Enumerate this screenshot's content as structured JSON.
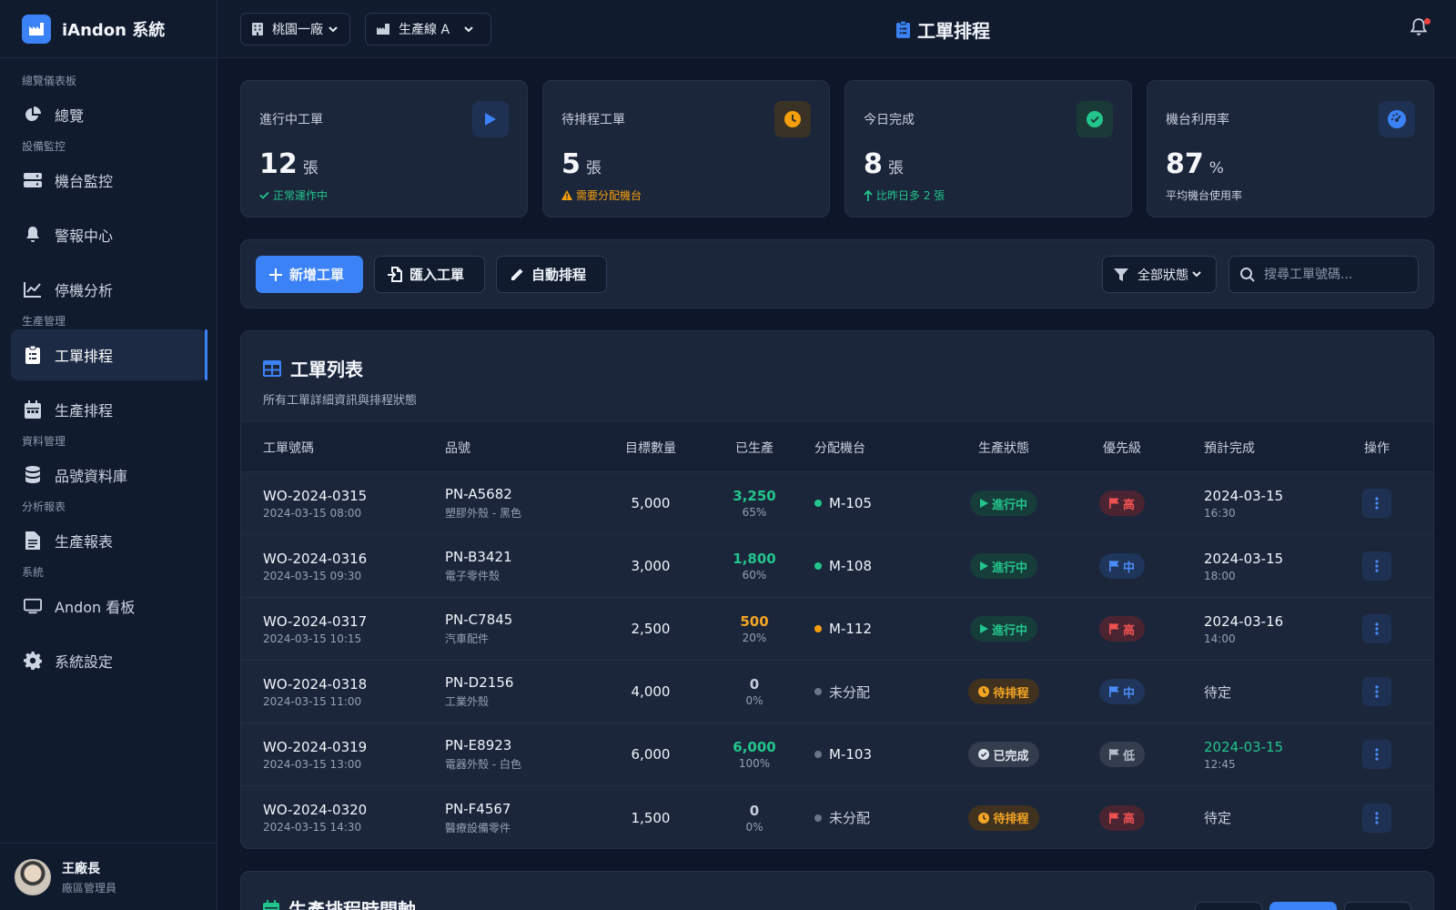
{
  "brand": {
    "title": "iAndon 系統"
  },
  "sidebar": {
    "sections": [
      {
        "label": "總覽儀表板",
        "items": [
          {
            "label": "總覽",
            "icon": "pie-chart-icon"
          }
        ]
      },
      {
        "label": "設備監控",
        "items": [
          {
            "label": "機台監控",
            "icon": "server-icon"
          },
          {
            "label": "警報中心",
            "icon": "bell-icon"
          },
          {
            "label": "停機分析",
            "icon": "line-chart-icon"
          }
        ]
      },
      {
        "label": "生產管理",
        "items": [
          {
            "label": "工單排程",
            "icon": "clipboard-icon",
            "active": true
          },
          {
            "label": "生產排程",
            "icon": "calendar-icon"
          }
        ]
      },
      {
        "label": "資料管理",
        "items": [
          {
            "label": "品號資料庫",
            "icon": "database-icon"
          }
        ]
      },
      {
        "label": "分析報表",
        "items": [
          {
            "label": "生產報表",
            "icon": "file-icon"
          }
        ]
      },
      {
        "label": "系統",
        "items": [
          {
            "label": "Andon 看板",
            "icon": "monitor-icon"
          },
          {
            "label": "系統設定",
            "icon": "gear-icon"
          }
        ]
      }
    ],
    "user": {
      "name": "王廠長",
      "role": "廠區管理員"
    }
  },
  "header": {
    "factory_select": "桃園一廠",
    "line_select": "生產線 A",
    "title": "工單排程"
  },
  "stats": [
    {
      "title": "進行中工單",
      "value": "12",
      "unit": "張",
      "sub": "正常運作中",
      "sub_color": "#22c58b",
      "icon": "play-icon",
      "icon_color": "#3b82f6"
    },
    {
      "title": "待排程工單",
      "value": "5",
      "unit": "張",
      "sub": "需要分配機台",
      "sub_color": "#f59e0b",
      "icon": "clock-icon",
      "icon_color": "#f59e0b"
    },
    {
      "title": "今日完成",
      "value": "8",
      "unit": "張",
      "sub": "比昨日多 2 張",
      "sub_color": "#22c58b",
      "icon": "check-circle-icon",
      "icon_color": "#22c58b"
    },
    {
      "title": "機台利用率",
      "value": "87",
      "unit": "%",
      "sub": "平均機台使用率",
      "sub_color": "#c7cfdc",
      "icon": "gauge-icon",
      "icon_color": "#3b82f6"
    }
  ],
  "toolbar": {
    "new_label": "新增工單",
    "import_label": "匯入工單",
    "auto_label": "自動排程",
    "filter_label": "全部狀態",
    "search_placeholder": "搜尋工單號碼..."
  },
  "table": {
    "title": "工單列表",
    "subtitle": "所有工單詳細資訊與排程狀態",
    "columns": [
      "工單號碼",
      "品號",
      "目標數量",
      "已生產",
      "分配機台",
      "生產狀態",
      "優先級",
      "預計完成",
      "操作"
    ],
    "rows": [
      {
        "wo": "WO-2024-0315",
        "wo_time": "2024-03-15 08:00",
        "pn": "PN-A5682",
        "pn_desc": "塑膠外殼 - 黑色",
        "target": "5,000",
        "produced": "3,250",
        "pct": "65%",
        "produced_color": "#22c58b",
        "machine": "M-105",
        "machine_color": "#22c58b",
        "status": "進行中",
        "status_type": "running",
        "priority": "高",
        "priority_type": "high",
        "eta_date": "2024-03-15",
        "eta_time": "16:30",
        "eta_color": "#f1f5fb"
      },
      {
        "wo": "WO-2024-0316",
        "wo_time": "2024-03-15 09:30",
        "pn": "PN-B3421",
        "pn_desc": "電子零件殼",
        "target": "3,000",
        "produced": "1,800",
        "pct": "60%",
        "produced_color": "#22c58b",
        "machine": "M-108",
        "machine_color": "#22c58b",
        "status": "進行中",
        "status_type": "running",
        "priority": "中",
        "priority_type": "mid",
        "eta_date": "2024-03-15",
        "eta_time": "18:00",
        "eta_color": "#f1f5fb"
      },
      {
        "wo": "WO-2024-0317",
        "wo_time": "2024-03-15 10:15",
        "pn": "PN-C7845",
        "pn_desc": "汽車配件",
        "target": "2,500",
        "produced": "500",
        "pct": "20%",
        "produced_color": "#f5a524",
        "machine": "M-112",
        "machine_color": "#f59e0b",
        "status": "進行中",
        "status_type": "running",
        "priority": "高",
        "priority_type": "high",
        "eta_date": "2024-03-16",
        "eta_time": "14:00",
        "eta_color": "#f1f5fb"
      },
      {
        "wo": "WO-2024-0318",
        "wo_time": "2024-03-15 11:00",
        "pn": "PN-D2156",
        "pn_desc": "工業外殼",
        "target": "4,000",
        "produced": "0",
        "pct": "0%",
        "produced_color": "#c7cfdc",
        "machine": "未分配",
        "machine_color": "#6b7588",
        "status": "待排程",
        "status_type": "pending",
        "priority": "中",
        "priority_type": "mid",
        "eta_date": "待定",
        "eta_time": "",
        "eta_color": "#c7cfdc"
      },
      {
        "wo": "WO-2024-0319",
        "wo_time": "2024-03-15 13:00",
        "pn": "PN-E8923",
        "pn_desc": "電器外殼 - 白色",
        "target": "6,000",
        "produced": "6,000",
        "pct": "100%",
        "produced_color": "#22c58b",
        "machine": "M-103",
        "machine_color": "#6b7588",
        "status": "已完成",
        "status_type": "done",
        "priority": "低",
        "priority_type": "low",
        "eta_date": "2024-03-15",
        "eta_time": "12:45",
        "eta_color": "#22c58b"
      },
      {
        "wo": "WO-2024-0320",
        "wo_time": "2024-03-15 14:30",
        "pn": "PN-F4567",
        "pn_desc": "醫療設備零件",
        "target": "1,500",
        "produced": "0",
        "pct": "0%",
        "produced_color": "#c7cfdc",
        "machine": "未分配",
        "machine_color": "#6b7588",
        "status": "待排程",
        "status_type": "pending",
        "priority": "高",
        "priority_type": "high",
        "eta_date": "待定",
        "eta_time": "",
        "eta_color": "#c7cfdc"
      }
    ]
  },
  "timeline": {
    "title": "生產排程時間軸"
  }
}
